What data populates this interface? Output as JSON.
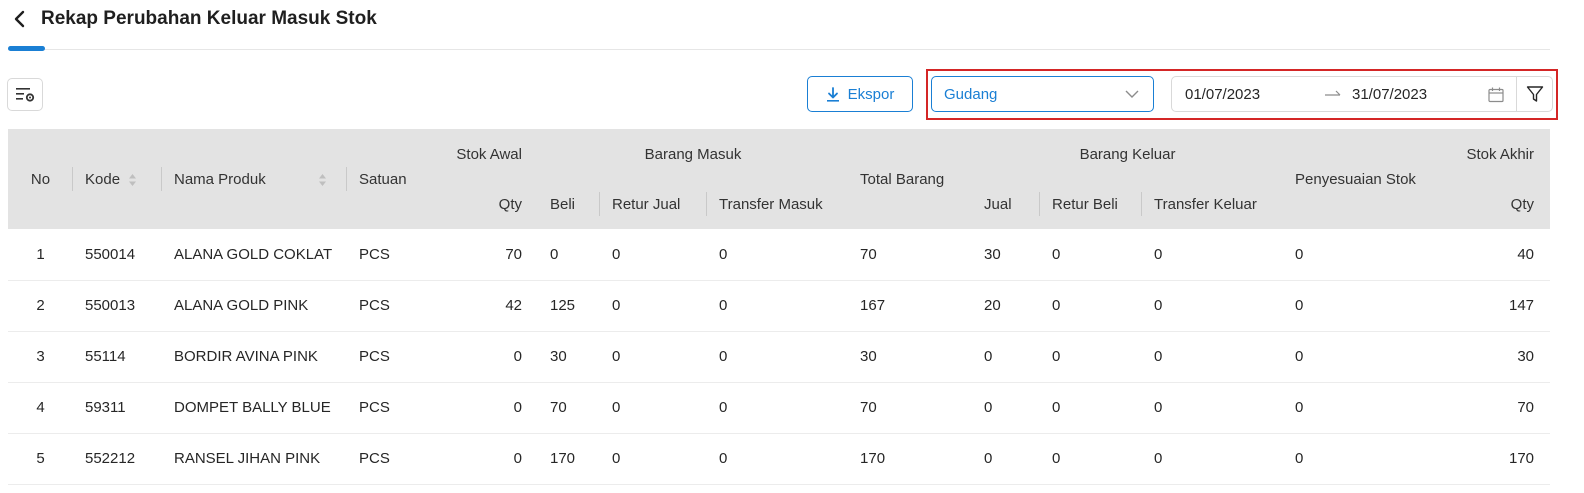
{
  "header": {
    "title": "Rekap Perubahan Keluar Masuk Stok"
  },
  "toolbar": {
    "export_label": "Ekspor",
    "warehouse": "Gudang",
    "date_start": "01/07/2023",
    "date_end": "31/07/2023"
  },
  "table": {
    "headers": {
      "no": "No",
      "kode": "Kode",
      "nama": "Nama Produk",
      "satuan": "Satuan",
      "stok_awal": "Stok Awal",
      "barang_masuk": "Barang Masuk",
      "total_barang": "Total Barang",
      "barang_keluar": "Barang Keluar",
      "penyesuaian": "Penyesuaian Stok",
      "stok_akhir": "Stok Akhir",
      "qty_awal": "Qty",
      "beli": "Beli",
      "retur_jual": "Retur Jual",
      "transfer_masuk": "Transfer Masuk",
      "jual": "Jual",
      "retur_beli": "Retur Beli",
      "transfer_keluar": "Transfer Keluar",
      "qty_akhir": "Qty"
    },
    "rows": [
      [
        "1",
        "550014",
        "ALANA GOLD COKLAT",
        "PCS",
        "70",
        "0",
        "0",
        "0",
        "70",
        "30",
        "0",
        "0",
        "0",
        "40"
      ],
      [
        "2",
        "550013",
        "ALANA GOLD PINK",
        "PCS",
        "42",
        "125",
        "0",
        "0",
        "167",
        "20",
        "0",
        "0",
        "0",
        "147"
      ],
      [
        "3",
        "55114",
        "BORDIR AVINA PINK",
        "PCS",
        "0",
        "30",
        "0",
        "0",
        "30",
        "0",
        "0",
        "0",
        "0",
        "30"
      ],
      [
        "4",
        "59311",
        "DOMPET BALLY BLUE",
        "PCS",
        "0",
        "70",
        "0",
        "0",
        "70",
        "0",
        "0",
        "0",
        "0",
        "70"
      ],
      [
        "5",
        "552212",
        "RANSEL JIHAN PINK",
        "PCS",
        "0",
        "170",
        "0",
        "0",
        "170",
        "0",
        "0",
        "0",
        "0",
        "170"
      ]
    ]
  },
  "colors": {
    "accent": "#1a7fd4",
    "highlight": "#d42626",
    "header_bg": "#e3e3e3"
  }
}
